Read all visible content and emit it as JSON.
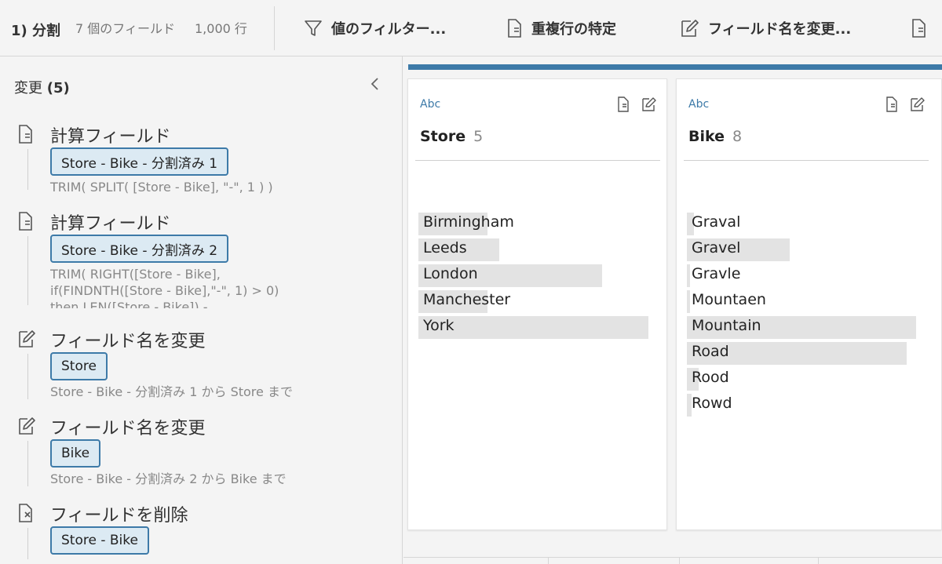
{
  "toolbar": {
    "step_label": "1) 分割",
    "field_count": "7 個のフィールド",
    "row_count": "1,000 行",
    "buttons": [
      {
        "label": "値のフィルター...",
        "icon": "filter-icon"
      },
      {
        "label": "重複行の特定",
        "icon": "document-icon"
      },
      {
        "label": "フィールド名を変更...",
        "icon": "rename-icon"
      }
    ]
  },
  "sidebar": {
    "title": "変更",
    "count": "(5)",
    "changes": [
      {
        "type": "計算フィールド",
        "icon": "calculated-field-icon",
        "pill": "Store - Bike - 分割済み 1",
        "detail": [
          "TRIM( SPLIT( [Store - Bike], \"-\", 1 ) )"
        ]
      },
      {
        "type": "計算フィールド",
        "icon": "calculated-field-icon",
        "pill": "Store - Bike - 分割済み 2",
        "detail": [
          "TRIM( RIGHT([Store - Bike],",
          "if(FINDNTH([Store - Bike],\"-\", 1) > 0)",
          "then LEN([Store - Bike]) -"
        ]
      },
      {
        "type": "フィールド名を変更",
        "icon": "rename-icon",
        "pill": "Store",
        "detail": [
          "Store - Bike - 分割済み 1 から Store まで"
        ]
      },
      {
        "type": "フィールド名を変更",
        "icon": "rename-icon",
        "pill": "Bike",
        "detail": [
          "Store - Bike - 分割済み 2 から Bike まで"
        ]
      },
      {
        "type": "フィールドを削除",
        "icon": "remove-field-icon",
        "pill": "Store - Bike",
        "detail": []
      }
    ]
  },
  "profile": {
    "cards": [
      {
        "type": "Abc",
        "name": "Store",
        "count": "5",
        "values": [
          {
            "label": "Birmingham",
            "share": 0.3
          },
          {
            "label": "Leeds",
            "share": 0.35
          },
          {
            "label": "London",
            "share": 0.8
          },
          {
            "label": "Manchester",
            "share": 0.3
          },
          {
            "label": "York",
            "share": 1.0
          }
        ]
      },
      {
        "type": "Abc",
        "name": "Bike",
        "count": "8",
        "values": [
          {
            "label": "Graval",
            "share": 0.03
          },
          {
            "label": "Gravel",
            "share": 0.45
          },
          {
            "label": "Gravle",
            "share": 0.01
          },
          {
            "label": "Mountaen",
            "share": 0.01
          },
          {
            "label": "Mountain",
            "share": 1.0
          },
          {
            "label": "Road",
            "share": 0.96
          },
          {
            "label": "Rood",
            "share": 0.05
          },
          {
            "label": "Rowd",
            "share": 0.02
          }
        ]
      }
    ]
  }
}
